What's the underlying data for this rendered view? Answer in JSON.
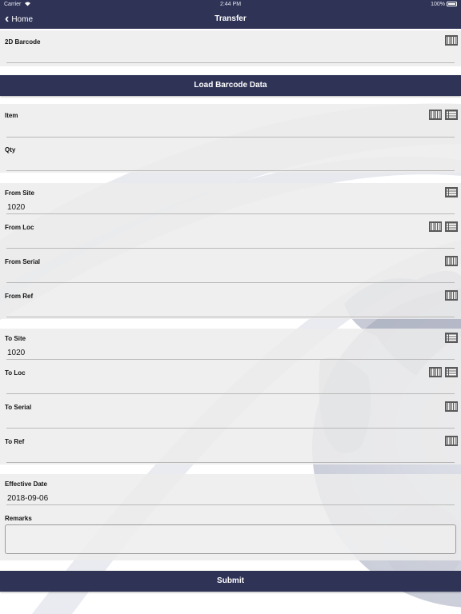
{
  "status_bar": {
    "carrier": "Carrier",
    "time": "2:44 PM",
    "battery": "100%"
  },
  "nav": {
    "back_label": "Home",
    "title": "Transfer"
  },
  "barcode_2d": {
    "label": "2D Barcode",
    "value": ""
  },
  "load_button": "Load Barcode Data",
  "item_group": [
    {
      "label": "Item",
      "value": "",
      "icons": [
        "barcode-icon",
        "list-icon"
      ]
    },
    {
      "label": "Qty",
      "value": "",
      "icons": []
    }
  ],
  "from_group": [
    {
      "label": "From Site",
      "value": "1020",
      "icons": [
        "list-icon"
      ]
    },
    {
      "label": "From Loc",
      "value": "",
      "icons": [
        "barcode-icon",
        "list-icon"
      ]
    },
    {
      "label": "From Serial",
      "value": "",
      "icons": [
        "barcode-icon"
      ]
    },
    {
      "label": "From Ref",
      "value": "",
      "icons": [
        "barcode-icon"
      ]
    }
  ],
  "to_group": [
    {
      "label": "To Site",
      "value": "1020",
      "icons": [
        "list-icon"
      ]
    },
    {
      "label": "To Loc",
      "value": "",
      "icons": [
        "barcode-icon",
        "list-icon"
      ]
    },
    {
      "label": "To Serial",
      "value": "",
      "icons": [
        "barcode-icon"
      ]
    },
    {
      "label": "To Ref",
      "value": "",
      "icons": [
        "barcode-icon"
      ]
    }
  ],
  "effective_date": {
    "label": "Effective Date",
    "value": "2018-09-06"
  },
  "remarks": {
    "label": "Remarks",
    "value": ""
  },
  "submit_button": "Submit",
  "colors": {
    "nav_bar": "#2f3356",
    "panel": "#ececec",
    "underline": "#b9b9b9"
  }
}
